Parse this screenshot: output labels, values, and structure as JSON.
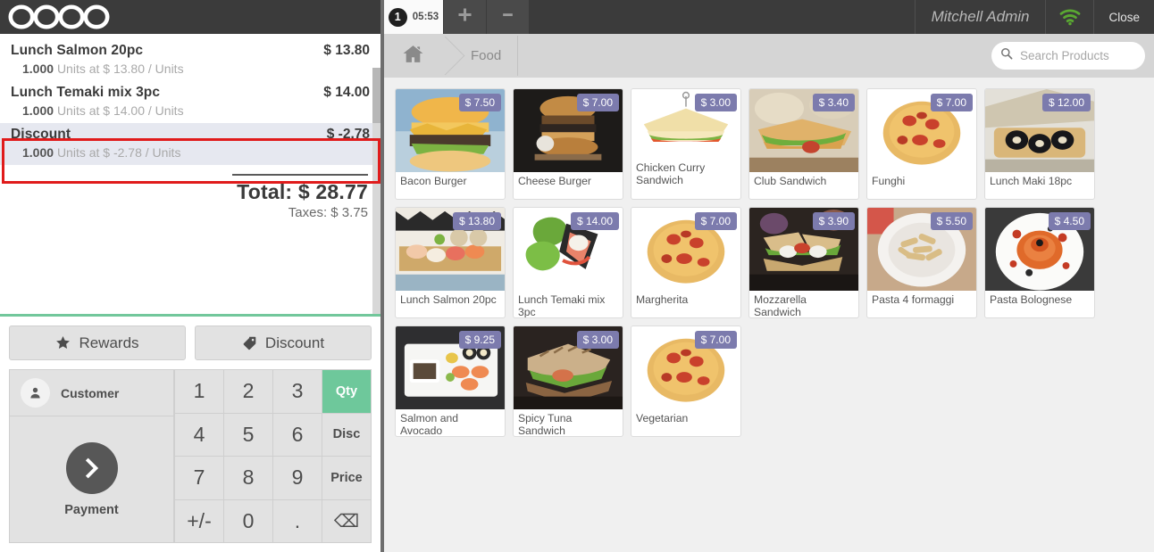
{
  "brand": {
    "logo_text": "odoo",
    "accent_purple": "#7c7bad",
    "accent_green": "#6ec89b"
  },
  "header": {
    "order_tab": {
      "badge": "1",
      "time": "05:53"
    },
    "add_order_label": "+",
    "remove_order_label": "—",
    "user_name": "Mitchell Admin",
    "wifi_icon": "wifi-icon",
    "close_label": "Close"
  },
  "breadcrumb": {
    "home_icon": "home-icon",
    "items": [
      {
        "label": "Food"
      }
    ]
  },
  "search": {
    "placeholder": "Search Products",
    "value": "",
    "icon": "search-icon",
    "clear_icon": "close-icon"
  },
  "order": {
    "lines": [
      {
        "name": "Lunch Salmon 20pc",
        "price": "$ 13.80",
        "qty": "1.000",
        "detail": "Units at $ 13.80 / Units",
        "selected": false
      },
      {
        "name": "Lunch Temaki mix 3pc",
        "price": "$ 14.00",
        "qty": "1.000",
        "detail": "Units at $ 14.00 / Units",
        "selected": false
      },
      {
        "name": "Discount",
        "price": "$ -2.78",
        "qty": "1.000",
        "detail": "Units at $ -2.78 / Units",
        "selected": true
      }
    ],
    "total_label": "Total: $ 28.77",
    "taxes_label": "Taxes: $ 3.75"
  },
  "actions": {
    "rewards_label": "Rewards",
    "rewards_icon": "star-icon",
    "discount_label": "Discount",
    "discount_icon": "tag-icon"
  },
  "pad": {
    "customer_label": "Customer",
    "customer_icon": "user-icon",
    "payment_label": "Payment",
    "payment_icon": "chevron-right-icon",
    "keys": [
      {
        "label": "1",
        "name": "numpad-1",
        "mode": false,
        "active": false
      },
      {
        "label": "2",
        "name": "numpad-2",
        "mode": false,
        "active": false
      },
      {
        "label": "3",
        "name": "numpad-3",
        "mode": false,
        "active": false
      },
      {
        "label": "Qty",
        "name": "numpad-qty",
        "mode": true,
        "active": true
      },
      {
        "label": "4",
        "name": "numpad-4",
        "mode": false,
        "active": false
      },
      {
        "label": "5",
        "name": "numpad-5",
        "mode": false,
        "active": false
      },
      {
        "label": "6",
        "name": "numpad-6",
        "mode": false,
        "active": false
      },
      {
        "label": "Disc",
        "name": "numpad-disc",
        "mode": true,
        "active": false
      },
      {
        "label": "7",
        "name": "numpad-7",
        "mode": false,
        "active": false
      },
      {
        "label": "8",
        "name": "numpad-8",
        "mode": false,
        "active": false
      },
      {
        "label": "9",
        "name": "numpad-9",
        "mode": false,
        "active": false
      },
      {
        "label": "Price",
        "name": "numpad-price",
        "mode": true,
        "active": false
      },
      {
        "label": "+/-",
        "name": "numpad-plusminus",
        "mode": false,
        "active": false
      },
      {
        "label": "0",
        "name": "numpad-0",
        "mode": false,
        "active": false
      },
      {
        "label": ".",
        "name": "numpad-decimal",
        "mode": false,
        "active": false
      },
      {
        "label": "⌫",
        "name": "numpad-backspace",
        "mode": false,
        "active": false
      }
    ]
  },
  "products": [
    {
      "name": "Bacon Burger",
      "price": "$ 7.50",
      "art": "burger-bacon"
    },
    {
      "name": "Cheese Burger",
      "price": "$ 7.00",
      "art": "burger-cheese"
    },
    {
      "name": "Chicken Curry Sandwich",
      "price": "$ 3.00",
      "art": "sandwich-toast"
    },
    {
      "name": "Club Sandwich",
      "price": "$ 3.40",
      "art": "sandwich-club"
    },
    {
      "name": "Funghi",
      "price": "$ 7.00",
      "art": "pizza"
    },
    {
      "name": "Lunch Maki 18pc",
      "price": "$ 12.00",
      "art": "maki"
    },
    {
      "name": "Lunch Salmon 20pc",
      "price": "$ 13.80",
      "art": "sushi-platter"
    },
    {
      "name": "Lunch Temaki mix 3pc",
      "price": "$ 14.00",
      "art": "temaki"
    },
    {
      "name": "Margherita",
      "price": "$ 7.00",
      "art": "pizza"
    },
    {
      "name": "Mozzarella Sandwich",
      "price": "$ 3.90",
      "art": "sandwich-mozzarella"
    },
    {
      "name": "Pasta 4 formaggi",
      "price": "$ 5.50",
      "art": "pasta-white"
    },
    {
      "name": "Pasta Bolognese",
      "price": "$ 4.50",
      "art": "pasta-red"
    },
    {
      "name": "Salmon and Avocado",
      "price": "$ 9.25",
      "art": "sushi-tray"
    },
    {
      "name": "Spicy Tuna Sandwich",
      "price": "$ 3.00",
      "art": "panini"
    },
    {
      "name": "Vegetarian",
      "price": "$ 7.00",
      "art": "pizza"
    }
  ]
}
